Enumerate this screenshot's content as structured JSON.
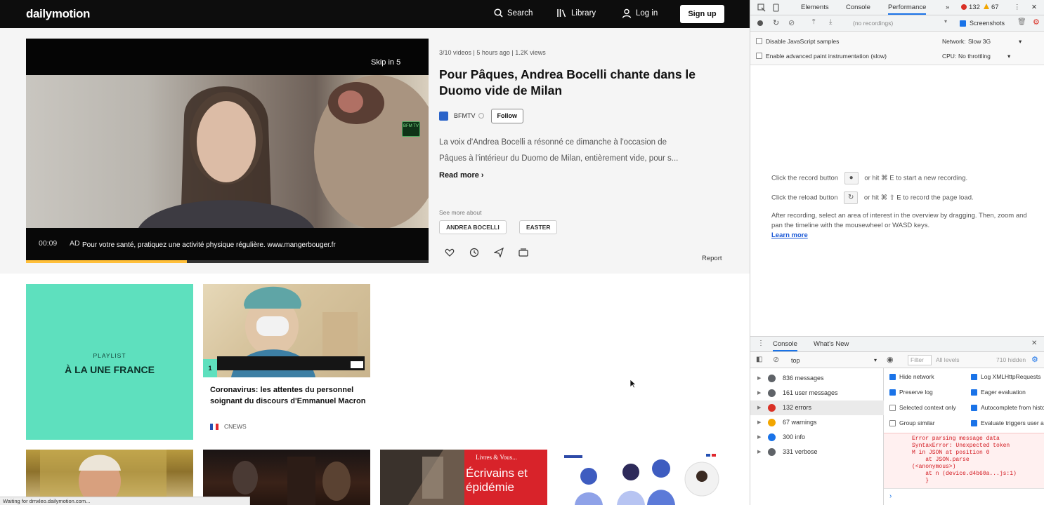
{
  "dailymotion": {
    "logo": "dailymotion",
    "nav": {
      "search": "Search",
      "library": "Library",
      "login": "Log in",
      "signup": "Sign up"
    },
    "player": {
      "skip": "Skip in 5",
      "time": "00:09",
      "ad_label": "AD",
      "ad_notice": "Pour votre santé, pratiquez une activité physique régulière. www.mangerbouger.fr",
      "progress": 0.4,
      "channel_badge": "BFM TV"
    },
    "video": {
      "meta": "3/10 videos | 5 hours ago | 1.2K views",
      "title": "Pour Pâques, Andrea Bocelli chante dans le Duomo vide de Milan",
      "channel": "BFMTV",
      "follow": "Follow",
      "description_line1": "La voix d'Andrea Bocelli a résonné ce dimanche à l'occasion de",
      "description_line2": "Pâques à l'intérieur du Duomo de Milan, entièrement vide, pour s...",
      "read_more": "Read more",
      "see_more_about": "See more about",
      "tags": [
        "ANDREA BOCELLI",
        "EASTER"
      ],
      "report": "Report"
    },
    "playlist": {
      "label": "PLAYLIST",
      "title": "À LA UNE FRANCE"
    },
    "card": {
      "number": "1",
      "title": "Coronavirus: les attentes du personnel soignant du discours d'Emmanuel Macron",
      "channel": "CNEWS"
    },
    "thumbs": {
      "t3_category": "Livres & Vous...",
      "t3_title": "Écrivains et épidémie"
    },
    "statusbar": "Waiting for dmxleo.dailymotion.com..."
  },
  "devtools": {
    "tabs": [
      "Elements",
      "Console",
      "Performance"
    ],
    "more_tabs": "»",
    "error_count": "132",
    "warning_count": "67",
    "recording_select": "(no recordings)",
    "screenshots": "Screenshots",
    "options": {
      "disable_js_samples": "Disable JavaScript samples",
      "advanced_paint": "Enable advanced paint instrumentation (slow)",
      "network_label": "Network:",
      "network_value": "Slow 3G",
      "cpu_label": "CPU:",
      "cpu_value": "No throttling"
    },
    "landing": {
      "record_pre": "Click the record button",
      "record_post": "or hit ⌘ E to start a new recording.",
      "reload_pre": "Click the reload button",
      "reload_post": "or hit ⌘ ⇧ E to record the page load.",
      "after": "After recording, select an area of interest in the overview by dragging. Then, zoom and pan the timeline with the mousewheel or WASD keys.",
      "learn_more": "Learn more"
    },
    "drawer": {
      "tabs": [
        "Console",
        "What's New"
      ]
    },
    "console": {
      "context": "top",
      "filter_placeholder": "Filter",
      "levels": "All levels",
      "hidden": "710 hidden",
      "sidebar": [
        {
          "label": "836 messages",
          "color": "#5f6368"
        },
        {
          "label": "161 user messages",
          "color": "#5f6368"
        },
        {
          "label": "132 errors",
          "color": "#d93025"
        },
        {
          "label": "67 warnings",
          "color": "#f2a600"
        },
        {
          "label": "300 info",
          "color": "#1a73e8"
        },
        {
          "label": "331 verbose",
          "color": "#5f6368"
        }
      ],
      "settings": {
        "hide_network": "Hide network",
        "log_xhr": "Log XMLHttpRequests",
        "preserve_log": "Preserve log",
        "eager_eval": "Eager evaluation",
        "selected_context": "Selected context only",
        "autocomplete": "Autocomplete from history",
        "group_similar": "Group similar",
        "eval_triggers": "Evaluate triggers user activation"
      },
      "error_lines": [
        "Error parsing message data",
        "SyntaxError: Unexpected token",
        "M in JSON at position 0",
        "    at JSON.parse",
        "(<anonymous>)",
        "    at n (device.d4b60a...js:1)",
        "    }"
      ]
    }
  }
}
